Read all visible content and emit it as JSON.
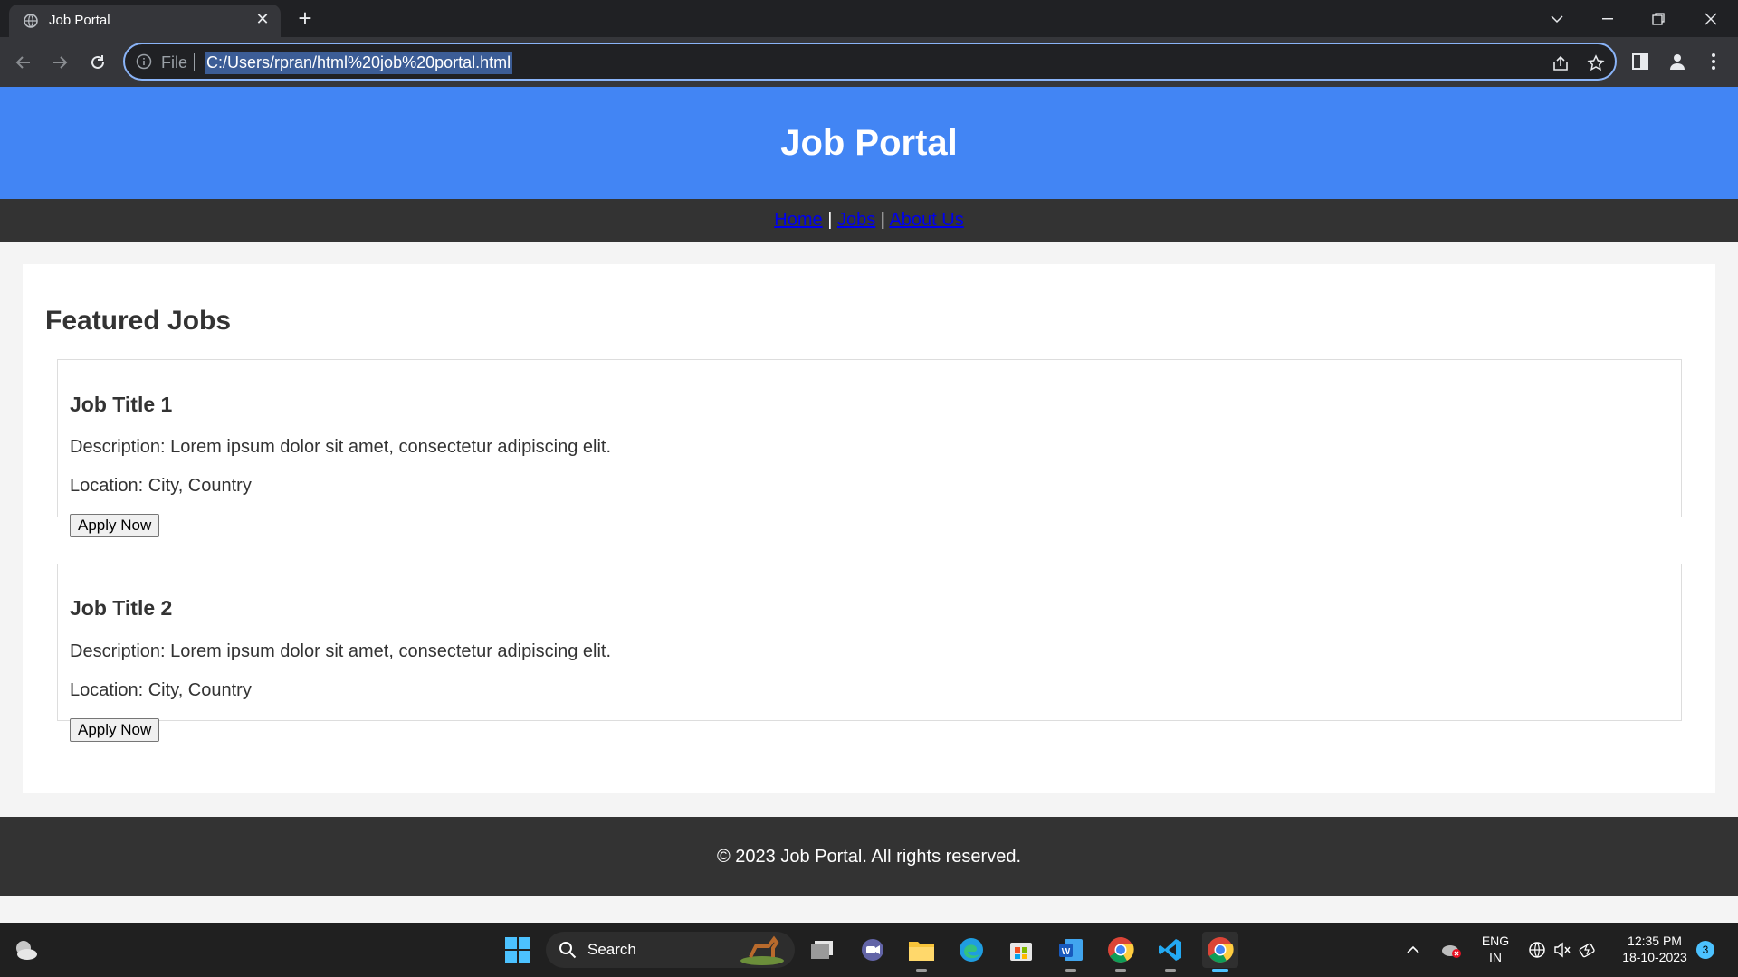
{
  "browser": {
    "tab_title": "Job Portal",
    "omnibox": {
      "scheme_label": "File",
      "url": "C:/Users/rpran/html%20job%20portal.html"
    }
  },
  "site": {
    "title": "Job Portal",
    "nav": [
      {
        "label": "Home"
      },
      {
        "label": "Jobs"
      },
      {
        "label": "About Us"
      }
    ],
    "nav_separator": "|",
    "section_heading": "Featured Jobs",
    "jobs": [
      {
        "title": "Job Title 1",
        "description": "Description: Lorem ipsum dolor sit amet, consectetur adipiscing elit.",
        "location": "Location: City, Country",
        "apply_label": "Apply Now"
      },
      {
        "title": "Job Title 2",
        "description": "Description: Lorem ipsum dolor sit amet, consectetur adipiscing elit.",
        "location": "Location: City, Country",
        "apply_label": "Apply Now"
      }
    ],
    "footer": "© 2023 Job Portal. All rights reserved."
  },
  "taskbar": {
    "search_label": "Search",
    "language": {
      "line1": "ENG",
      "line2": "IN"
    },
    "clock": {
      "time": "12:35 PM",
      "date": "18-10-2023"
    },
    "notification_count": "3"
  },
  "colors": {
    "header_bg": "#4285f4",
    "nav_bg": "#333333",
    "link": "#0000ee"
  }
}
